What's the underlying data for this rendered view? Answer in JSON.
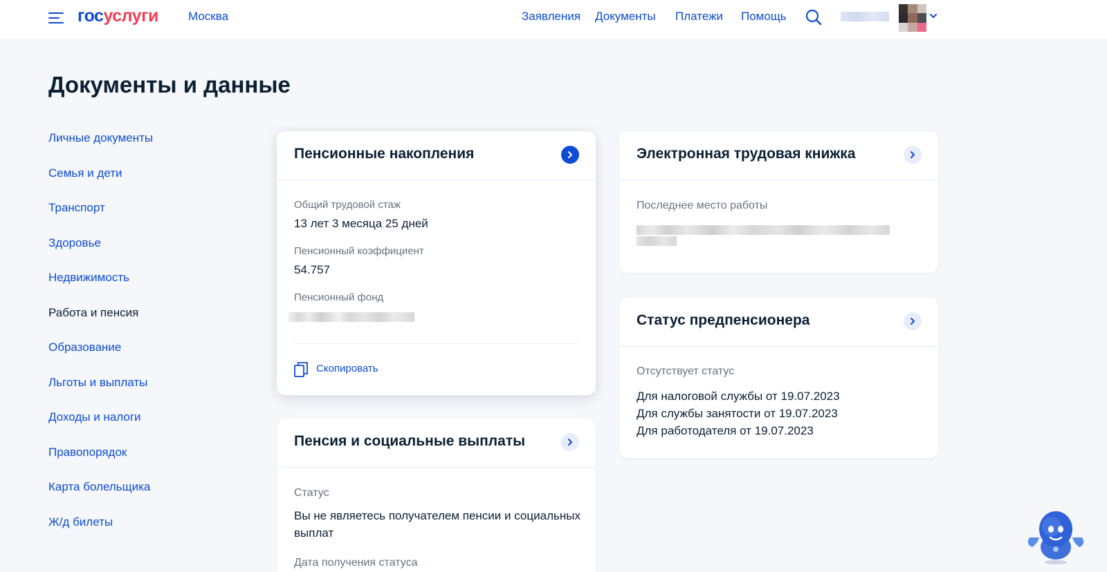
{
  "header": {
    "logo_part1": "гос",
    "logo_part2": "услуги",
    "city": "Москва",
    "nav": [
      "Заявления",
      "Документы",
      "Платежи",
      "Помощь"
    ]
  },
  "page": {
    "title": "Документы и данные"
  },
  "sidebar": {
    "items": [
      {
        "label": "Личные документы"
      },
      {
        "label": "Семья и дети"
      },
      {
        "label": "Транспорт"
      },
      {
        "label": "Здоровье"
      },
      {
        "label": "Недвижимость"
      },
      {
        "label": "Работа и пенсия"
      },
      {
        "label": "Образование"
      },
      {
        "label": "Льготы и выплаты"
      },
      {
        "label": "Доходы и налоги"
      },
      {
        "label": "Правопорядок"
      },
      {
        "label": "Карта болельщика"
      },
      {
        "label": "Ж/д билеты"
      }
    ]
  },
  "pension_savings": {
    "title": "Пенсионные накопления",
    "experience_label": "Общий трудовой стаж",
    "experience_value": "13 лет 3 месяца 25 дней",
    "coefficient_label": "Пенсионный коэффициент",
    "coefficient_value": "54.757",
    "fund_label": "Пенсионный фонд",
    "copy_label": "Скопировать"
  },
  "pension_payments": {
    "title": "Пенсия и социальные выплаты",
    "status_label": "Статус",
    "status_value": "Вы не являетесь получателем пенсии и социальных выплат",
    "date_label": "Дата получения статуса"
  },
  "work_book": {
    "title": "Электронная трудовая книжка",
    "last_job_label": "Последнее место работы"
  },
  "prepension": {
    "title": "Статус предпенсионера",
    "status": "Отсутствует статус",
    "lines": [
      "Для налоговой службы от 19.07.2023",
      "Для службы занятости от 19.07.2023",
      "Для работодателя от 19.07.2023"
    ]
  },
  "colors": {
    "brand_blue": "#0d4cd3",
    "brand_red": "#ee3f58",
    "text": "#0b1f33",
    "muted": "#66727f",
    "background": "#f5f7fa"
  },
  "icons": [
    "menu-icon",
    "search-icon",
    "chevron-down-icon",
    "chevron-right-icon",
    "copy-icon",
    "assistant-robot-icon"
  ]
}
